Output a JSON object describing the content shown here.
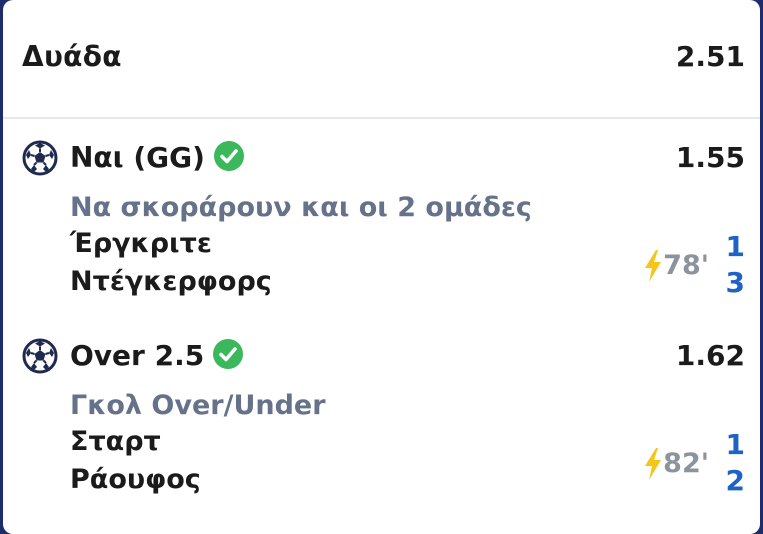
{
  "header": {
    "title": "Δυάδα",
    "odds": "2.51"
  },
  "legs": [
    {
      "selection": "Ναι (GG)",
      "odds": "1.55",
      "market": "Να σκοράρουν και οι 2 ομάδες",
      "home_team": "Έργκριτε",
      "away_team": "Ντέγκερφορς",
      "minute": "78'",
      "home_score": "1",
      "away_score": "3",
      "status": "won"
    },
    {
      "selection": "Over 2.5",
      "odds": "1.62",
      "market": "Γκολ Over/Under",
      "home_team": "Σταρτ",
      "away_team": "Ράουφος",
      "minute": "82'",
      "home_score": "1",
      "away_score": "2",
      "status": "won"
    }
  ],
  "icons": {
    "sport": "soccer-ball-icon",
    "status": "check-circle-icon",
    "live": "lightning-bolt-icon"
  },
  "colors": {
    "check": "#3cb85c",
    "score": "#1d63c6",
    "bolt": "#f5c61a",
    "market_text": "#667289",
    "minute_text": "#8d939c",
    "background": "#1d2c6b"
  }
}
